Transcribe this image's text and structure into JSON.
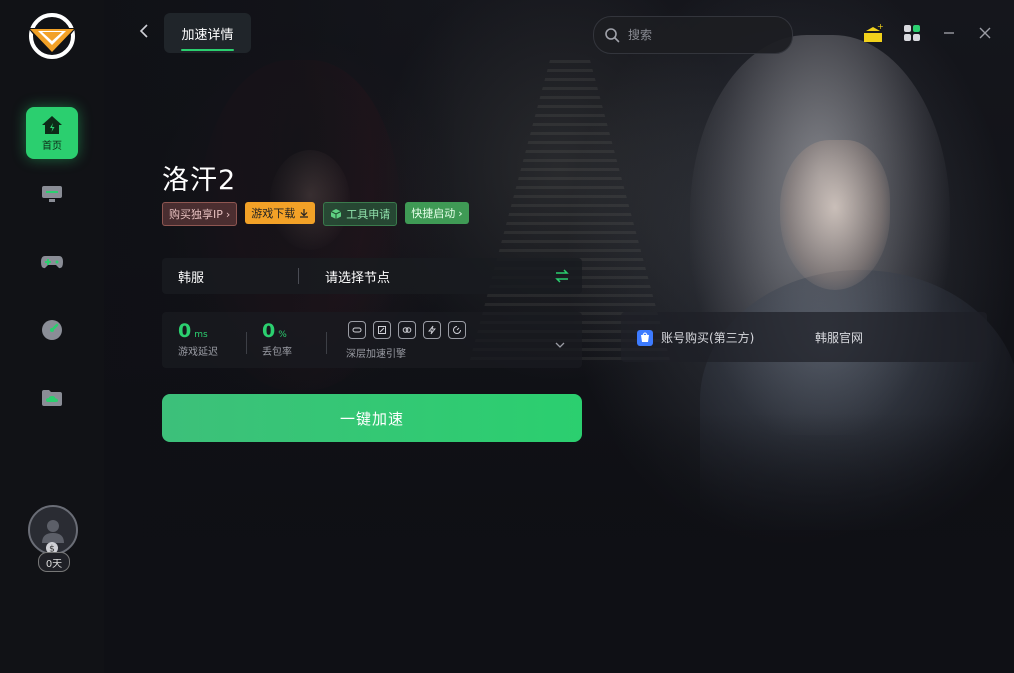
{
  "header": {
    "back_icon": "chevron-left-icon",
    "tab_label": "加速详情",
    "search_placeholder": "搜索"
  },
  "sidebar": {
    "items": [
      {
        "icon": "home-icon",
        "label": "首页",
        "active": true
      },
      {
        "icon": "monitor-icon"
      },
      {
        "icon": "gamepad-icon"
      },
      {
        "icon": "speedometer-icon"
      },
      {
        "icon": "cloud-folder-icon"
      }
    ],
    "days_label": "0天"
  },
  "game": {
    "title": "洛汗2",
    "tags": {
      "buy_ip": "购买独享IP",
      "download": "游戏下载",
      "tools": "工具申请",
      "quick_start": "快捷启动"
    },
    "region": "韩服",
    "node_placeholder": "请选择节点",
    "stats": {
      "latency_value": "0",
      "latency_unit": "ms",
      "latency_label": "游戏延迟",
      "loss_value": "0",
      "loss_unit": "%",
      "loss_label": "丢包率",
      "engine_label": "深层加速引擎"
    },
    "accelerate_button": "一键加速"
  },
  "links": {
    "account_buy": "账号购买(第三方)",
    "official_site": "韩服官网"
  },
  "colors": {
    "accent": "#2bcf6f",
    "download_tag": "#f2a127"
  }
}
